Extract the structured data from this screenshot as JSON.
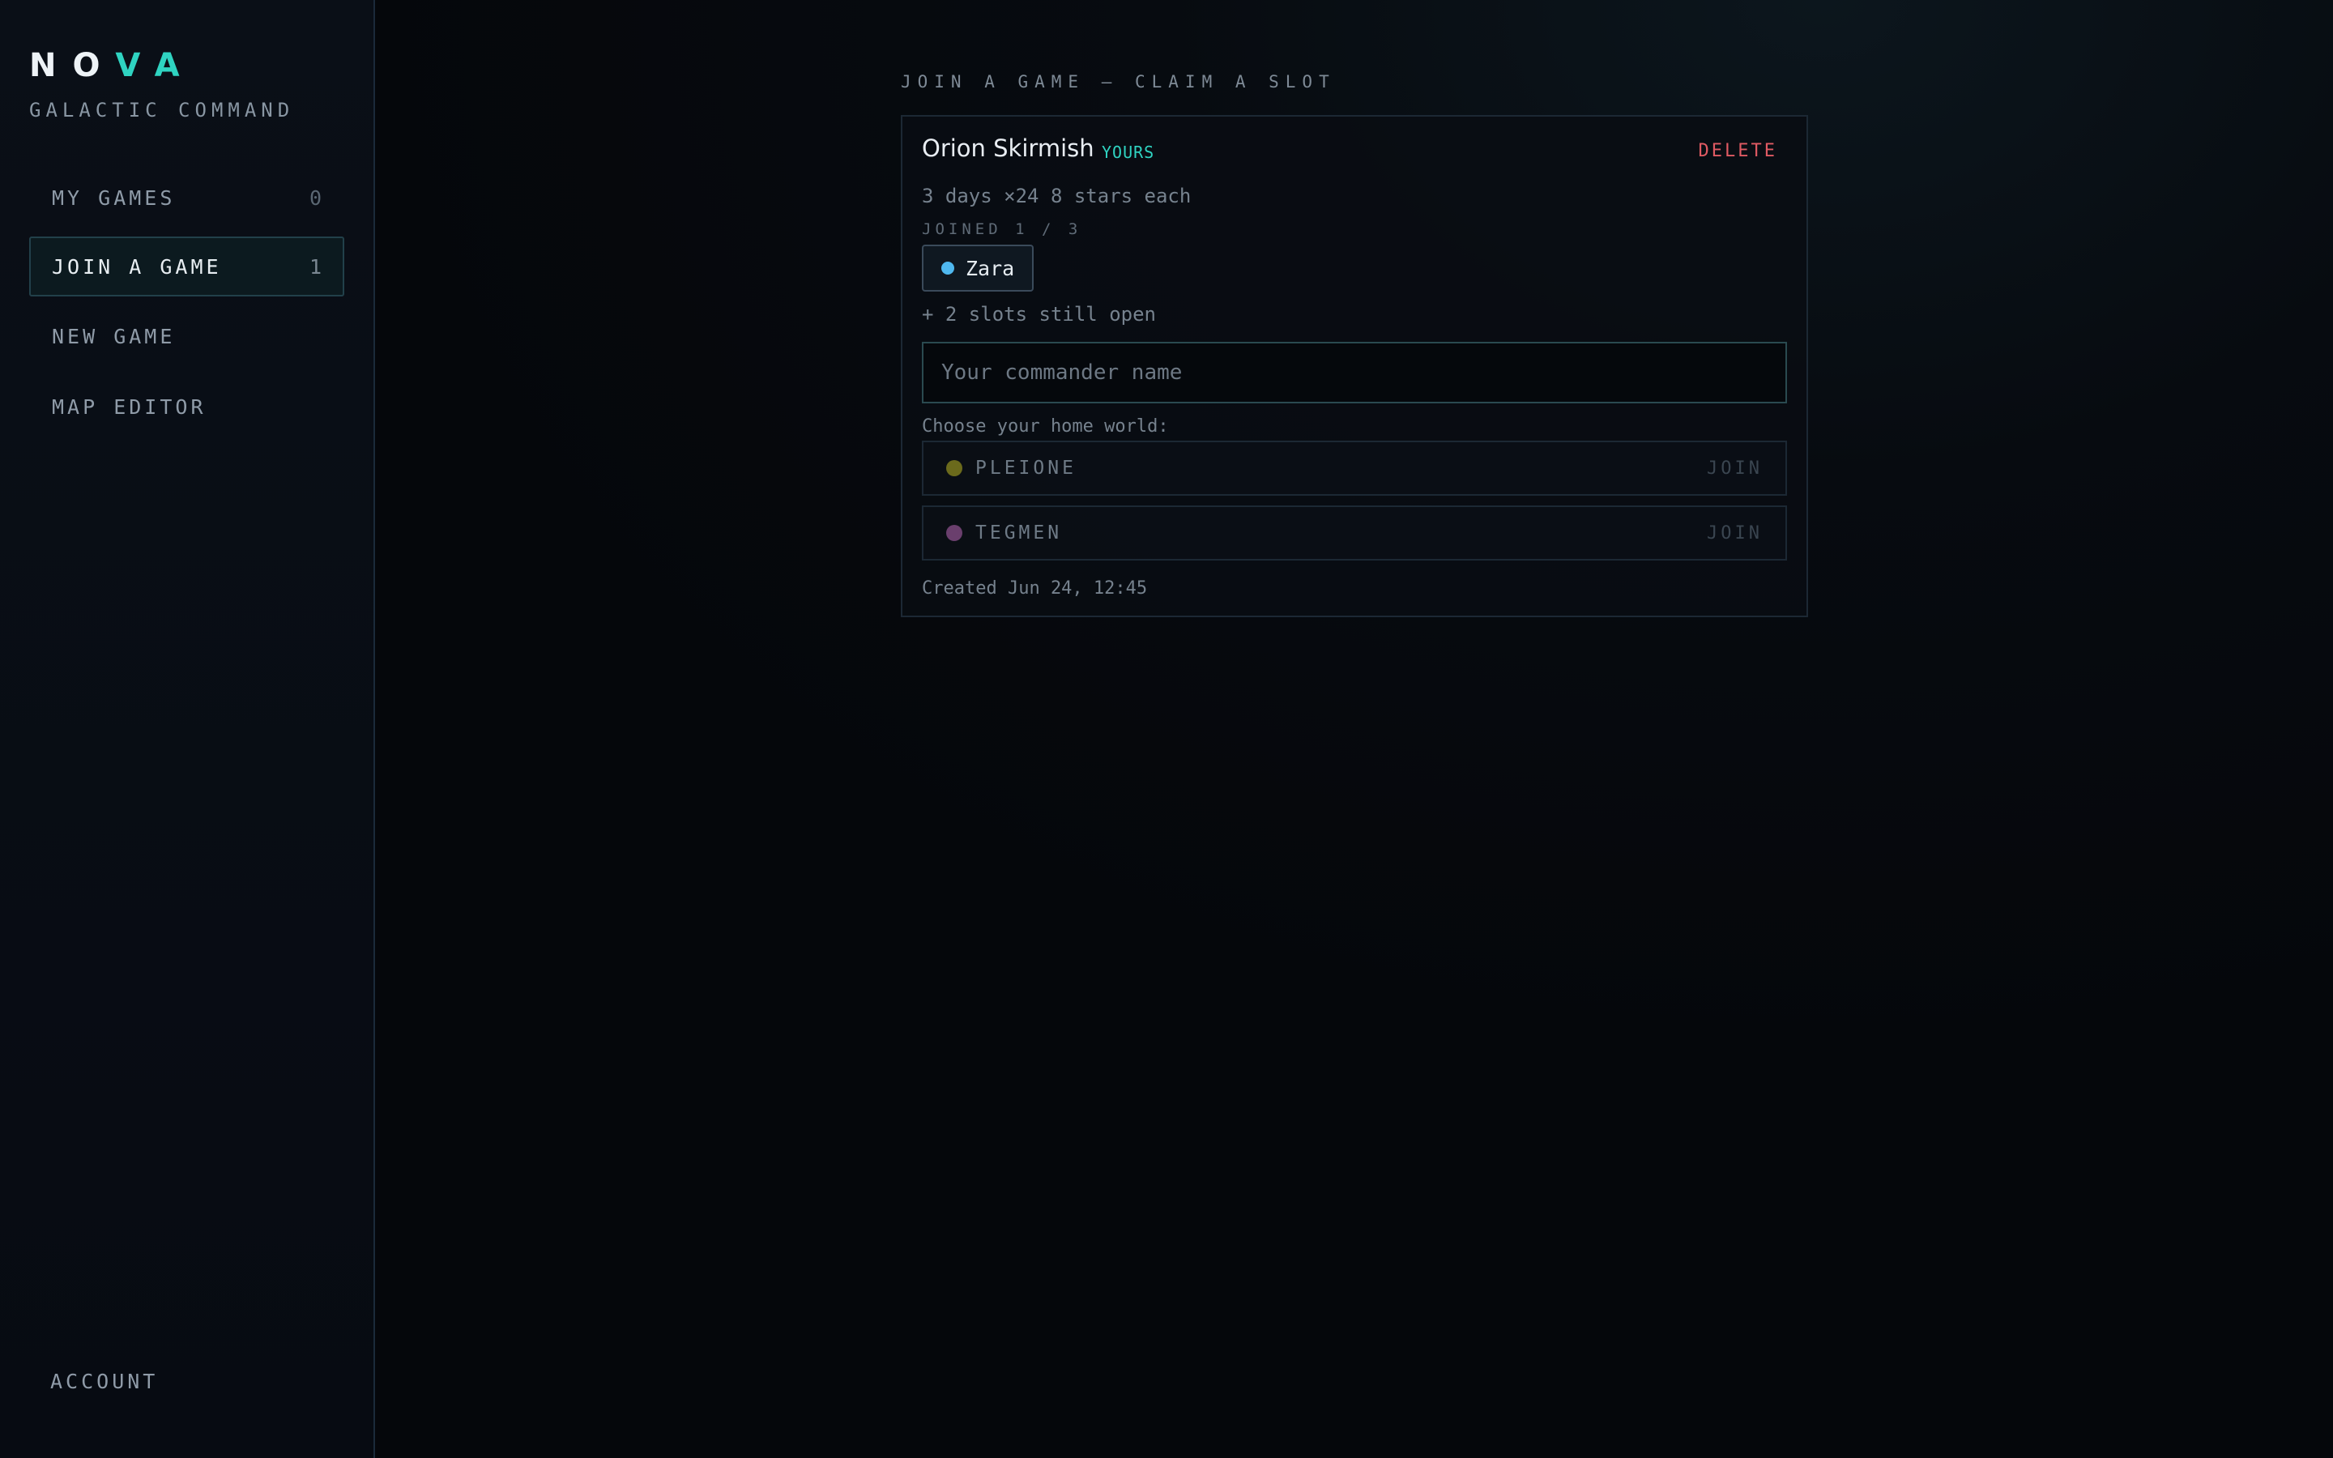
{
  "sidebar": {
    "logo_part1": "NO",
    "logo_part2": "VA",
    "subtitle": "GALACTIC COMMAND",
    "items": [
      {
        "label": "MY GAMES",
        "count": "0"
      },
      {
        "label": "JOIN A GAME",
        "count": "1",
        "active": true
      },
      {
        "label": "NEW GAME",
        "count": ""
      },
      {
        "label": "MAP EDITOR",
        "count": ""
      }
    ],
    "account_label": "ACCOUNT"
  },
  "main": {
    "heading": "JOIN A GAME — CLAIM A SLOT",
    "game": {
      "title": "Orion Skirmish",
      "tag": "YOURS",
      "delete_label": "DELETE",
      "meta": "3 days ×24 8 stars each",
      "joined_label": "JOINED 1 / 3",
      "players": [
        {
          "name": "Zara",
          "color": "#4fb8ef"
        }
      ],
      "open_slots": "+ 2 slots still open",
      "name_placeholder": "Your commander name",
      "name_value": "",
      "choose_label": "Choose your home world:",
      "worlds": [
        {
          "name": "PLEIONE",
          "color": "#6b6a1c",
          "action": "JOIN"
        },
        {
          "name": "TEGMEN",
          "color": "#6a3f6d",
          "action": "JOIN"
        }
      ],
      "created": "Created Jun 24, 12:45"
    }
  },
  "colors": {
    "accent": "#2fd3c1",
    "danger": "#e05a63",
    "background": "#05070b"
  }
}
